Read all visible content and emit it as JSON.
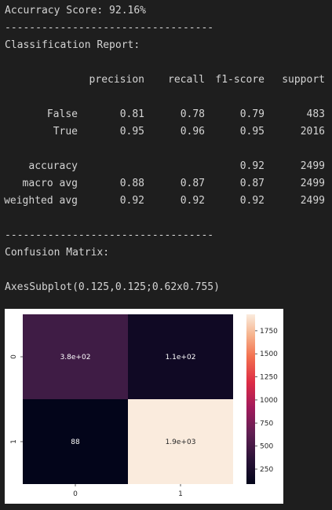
{
  "accuracy_line": "Accurracy Score: 92.16%",
  "separator": "----------------------------------",
  "report_title": "Classification Report:",
  "report": {
    "columns": [
      "precision",
      "recall",
      "f1-score",
      "support"
    ],
    "rows": [
      {
        "label": "False",
        "values": [
          "0.81",
          "0.78",
          "0.79",
          "483"
        ]
      },
      {
        "label": "True",
        "values": [
          "0.95",
          "0.96",
          "0.95",
          "2016"
        ]
      },
      {
        "label": "accuracy",
        "values": [
          "",
          "",
          "0.92",
          "2499"
        ]
      },
      {
        "label": "macro avg",
        "values": [
          "0.88",
          "0.87",
          "0.87",
          "2499"
        ]
      },
      {
        "label": "weighted avg",
        "values": [
          "0.92",
          "0.92",
          "0.92",
          "2499"
        ]
      }
    ]
  },
  "confusion_title": "Confusion Matrix:",
  "axes_repr": "AxesSubplot(0.125,0.125;0.62x0.755)",
  "heatmap": {
    "cells": [
      {
        "row": 0,
        "col": 0,
        "value": 380,
        "label": "3.8e+02",
        "color": "#3f1c45"
      },
      {
        "row": 0,
        "col": 1,
        "value": 110,
        "label": "1.1e+02",
        "color": "#100924"
      },
      {
        "row": 1,
        "col": 0,
        "value": 88,
        "label": "88",
        "color": "#03051a"
      },
      {
        "row": 1,
        "col": 1,
        "value": 1900,
        "label": "1.9e+03",
        "color": "#faebdd"
      }
    ],
    "x_ticks": [
      "0",
      "1"
    ],
    "y_ticks": [
      "0",
      "1"
    ],
    "colorbar_ticks": [
      "1750",
      "1500",
      "1250",
      "1000",
      "750",
      "500",
      "250"
    ],
    "colorbar_range": [
      88,
      1928
    ]
  }
}
